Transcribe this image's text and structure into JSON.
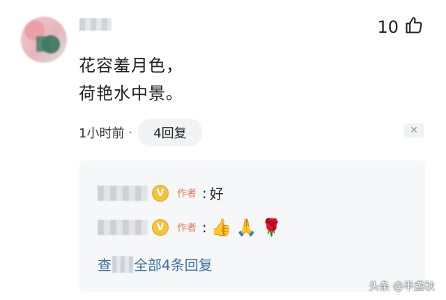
{
  "comment": {
    "likes_count": "10",
    "line1": "花容羞月色，",
    "line2": "荷艳水中景。",
    "time": "1小时前",
    "dot": "·",
    "reply_count_label": "4回复",
    "close_symbol": "✕"
  },
  "replies": [
    {
      "author_tag": "作者",
      "colon": ":",
      "text": "好",
      "badge": "V"
    },
    {
      "author_tag": "作者",
      "colon": ":",
      "emojis": [
        "👍",
        "🙏",
        "🌹"
      ],
      "badge": "V"
    }
  ],
  "view_all": {
    "prefix": "查",
    "suffix": "全部4条回复"
  },
  "watermark": "头条 @半盏秋",
  "colors": {
    "link": "#3c6ea8",
    "author_tag": "#e07a5f",
    "badge": "#f6c23a"
  }
}
